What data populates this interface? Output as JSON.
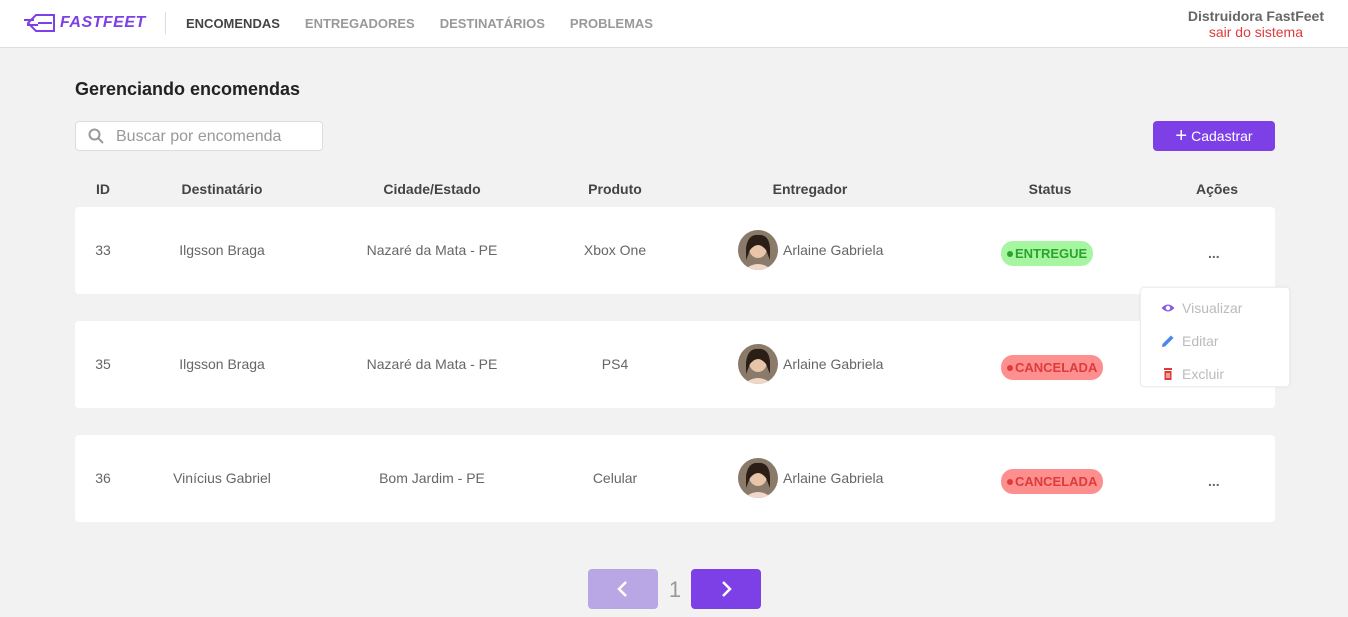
{
  "brand": {
    "name": "FASTFEET",
    "color": "#7d40e7"
  },
  "nav": {
    "items": [
      {
        "label": "ENCOMENDAS",
        "active": true
      },
      {
        "label": "ENTREGADORES",
        "active": false
      },
      {
        "label": "DESTINATÁRIOS",
        "active": false
      },
      {
        "label": "PROBLEMAS",
        "active": false
      }
    ]
  },
  "user": {
    "name": "Distruidora FastFeet",
    "logout_label": "sair do sistema"
  },
  "page": {
    "title": "Gerenciando encomendas"
  },
  "search": {
    "placeholder": "Buscar por encomenda",
    "value": "",
    "icon": "search-icon"
  },
  "actions": {
    "add_label": "Cadastrar"
  },
  "table": {
    "headers": [
      "ID",
      "Destinatário",
      "Cidade/Estado",
      "Produto",
      "Entregador",
      "Status",
      "Ações"
    ],
    "rows": [
      {
        "id": "33",
        "recipient": "Ilgsson Braga",
        "city": "Nazaré da Mata - PE",
        "product": "Xbox One",
        "deliverer": "Arlaine Gabriela",
        "status": "ENTREGUE",
        "actions": "..."
      },
      {
        "id": "35",
        "recipient": "Ilgsson Braga",
        "city": "Nazaré da Mata - PE",
        "product": "PS4",
        "deliverer": "Arlaine Gabriela",
        "status": "CANCELADA",
        "actions": "..."
      },
      {
        "id": "36",
        "recipient": "Vinícius Gabriel",
        "city": "Bom Jardim - PE",
        "product": "Celular",
        "deliverer": "Arlaine Gabriela",
        "status": "CANCELADA",
        "actions": "..."
      }
    ]
  },
  "action_menu": {
    "items": [
      {
        "label": "Visualizar",
        "icon": "eye-icon",
        "color": "#8e5be8"
      },
      {
        "label": "Editar",
        "icon": "pencil-icon",
        "color": "#4d85ee"
      },
      {
        "label": "Excluir",
        "icon": "trash-icon",
        "color": "#de3b3b"
      }
    ]
  },
  "pagination": {
    "current_page": "1"
  },
  "status_colors": {
    "ENTREGUE": {
      "bg": "#a6f5a1",
      "fg": "#2ca42b"
    },
    "CANCELADA": {
      "bg": "#fd8f8f",
      "fg": "#de3b3b"
    }
  }
}
